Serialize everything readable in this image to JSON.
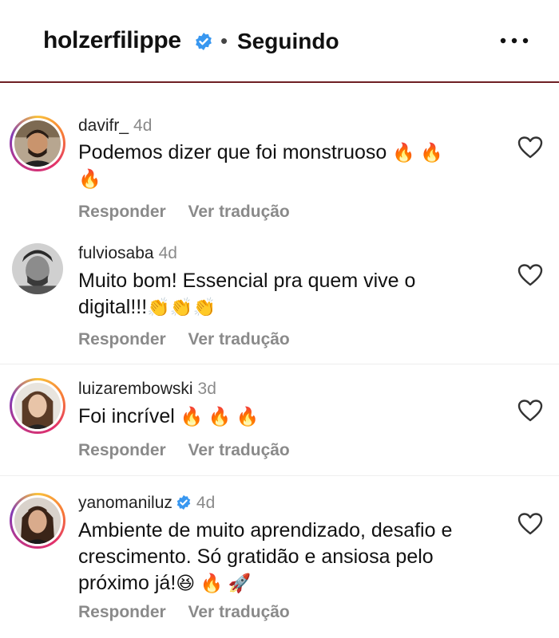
{
  "header": {
    "username": "holzerfilippe",
    "separator": "•",
    "follow_status": "Seguindo"
  },
  "comments": [
    {
      "username": "davifr_",
      "time": "4d",
      "text": "Podemos dizer que foi monstruoso",
      "text_cont": "",
      "emojis_inline": "🔥 🔥",
      "emojis_line2": "🔥",
      "reply_label": "Responder",
      "translate_label": "Ver tradução",
      "avatar_ring": true
    },
    {
      "username": "fulviosaba",
      "time": "4d",
      "text": "Muito bom! Essencial pra quem vive o",
      "text_cont": "digital!!!",
      "emojis_line2": "👏👏👏",
      "reply_label": "Responder",
      "translate_label": "Ver tradução",
      "avatar_ring": false
    },
    {
      "username": "luizarembowski",
      "time": "3d",
      "text": "Foi incrível",
      "emojis_inline": "🔥 🔥 🔥",
      "reply_label": "Responder",
      "translate_label": "Ver tradução",
      "avatar_ring": true
    },
    {
      "username": "yanomaniluz",
      "time": "4d",
      "verified": true,
      "text_line1": "Ambiente de muito aprendizado, desafio e",
      "text_line2": "crescimento. Só gratidão e ansiosa pelo",
      "text_line3": "próximo já!",
      "emojis_line3": "😆 🔥 🚀",
      "reply_label": "Responder",
      "translate_label": "Ver tradução",
      "avatar_ring": true
    }
  ],
  "icons": {
    "verified": "verified-badge-icon",
    "more": "more-options-icon",
    "like": "heart-icon"
  },
  "colors": {
    "verified_blue": "#3897f0",
    "header_border": "#6e1f23",
    "muted": "#8a8a8a"
  }
}
